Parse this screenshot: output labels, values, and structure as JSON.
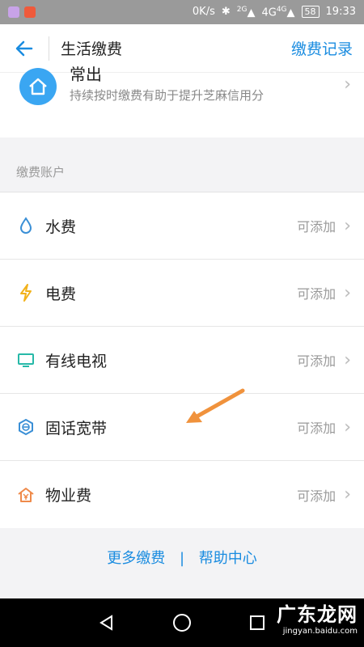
{
  "status_bar": {
    "speed": "0K/s",
    "network1": "4G",
    "network1_badge": "2G",
    "network2": "4G",
    "network2_badge": "4G",
    "battery": "58",
    "time": "19:33"
  },
  "nav": {
    "title": "生活缴费",
    "action": "缴费记录"
  },
  "promo": {
    "title": "常出",
    "description": "持续按时缴费有助于提升芝麻信用分"
  },
  "section": {
    "label": "缴费账户"
  },
  "items": [
    {
      "label": "水费",
      "status": "可添加",
      "icon": "water-drop-icon",
      "color": "#3a8fd6"
    },
    {
      "label": "电费",
      "status": "可添加",
      "icon": "lightning-icon",
      "color": "#f2b21b"
    },
    {
      "label": "有线电视",
      "status": "可添加",
      "icon": "tv-icon",
      "color": "#27b9a8"
    },
    {
      "label": "固话宽带",
      "status": "可添加",
      "icon": "broadband-icon",
      "color": "#3a8fd6"
    },
    {
      "label": "物业费",
      "status": "可添加",
      "icon": "property-icon",
      "color": "#ef8a4a"
    }
  ],
  "footer": {
    "more": "更多缴费",
    "separator": "|",
    "help": "帮助中心"
  },
  "watermark": {
    "main": "广东龙网",
    "sub": "jingyan.baidu.com"
  },
  "colors": {
    "accent": "#1a8ce0",
    "annotation_arrow": "#f0923c"
  }
}
